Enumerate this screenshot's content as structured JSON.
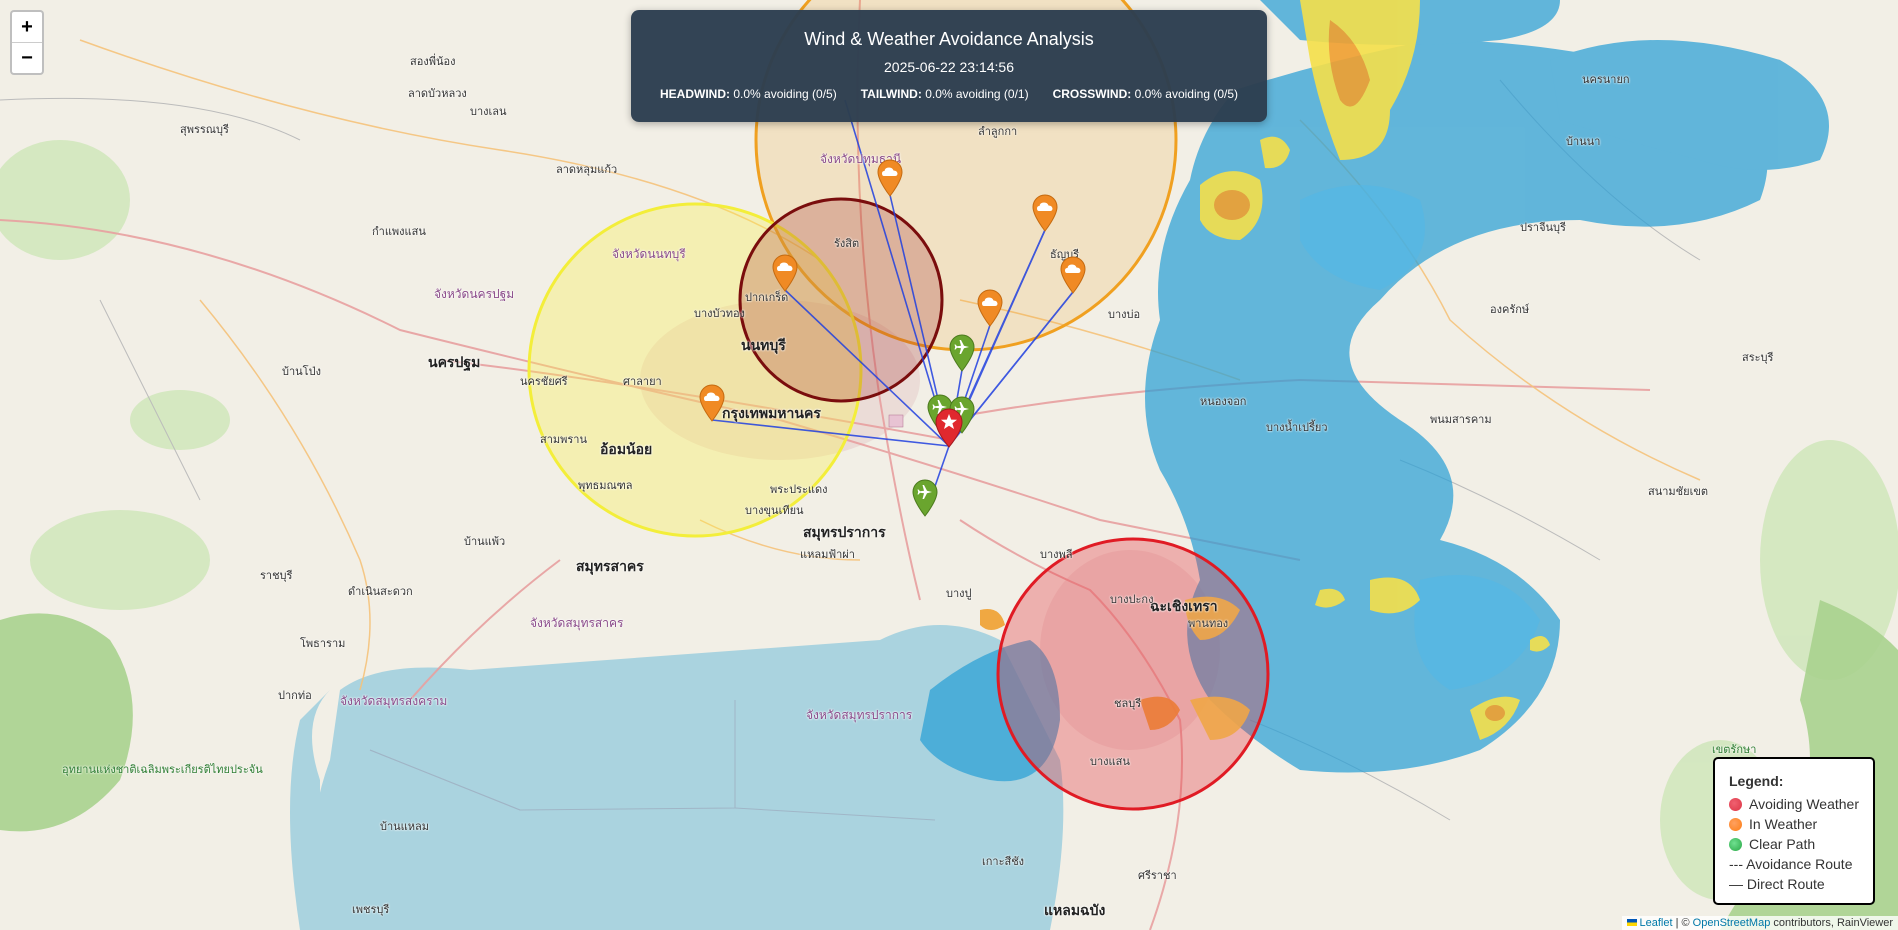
{
  "zoom": {
    "in_label": "+",
    "out_label": "−"
  },
  "panel": {
    "title": "Wind & Weather Avoidance Analysis",
    "timestamp": "2025-06-22 23:14:56",
    "headwind": {
      "label": "HEADWIND:",
      "value": "0.0% avoiding (0/5)"
    },
    "tailwind": {
      "label": "TAILWIND:",
      "value": "0.0% avoiding (0/1)"
    },
    "crosswind": {
      "label": "CROSSWIND:",
      "value": "0.0% avoiding (0/5)"
    }
  },
  "legend": {
    "title": "Legend:",
    "avoiding": "Avoiding Weather",
    "in_weather": "In Weather",
    "clear": "Clear Path",
    "avoid_route": "--- Avoidance Route",
    "direct_route": "— Direct Route",
    "colors": {
      "avoiding": "#dc3545",
      "in_weather": "#fd7e14",
      "clear": "#28a745"
    }
  },
  "attribution": {
    "leaflet": "Leaflet",
    "sep": " | © ",
    "osm": "OpenStreetMap",
    "rest": " contributors, RainViewer"
  },
  "markers": {
    "weather_icon": "cloud-icon",
    "aircraft_icon": "airplane-icon",
    "target_icon": "star-icon"
  },
  "places": [
    {
      "n": "place-1",
      "t": "นครปฐม",
      "k": "city"
    },
    {
      "n": "place-2",
      "t": "นนทบุรี",
      "k": "city"
    },
    {
      "n": "place-3",
      "t": "กรุงเทพมหานคร",
      "k": "city"
    },
    {
      "n": "place-4",
      "t": "สมุทรปราการ",
      "k": "city"
    },
    {
      "n": "place-5",
      "t": "สมุทรสาคร",
      "k": "city"
    },
    {
      "n": "place-6",
      "t": "อ้อมน้อย",
      "k": "city"
    },
    {
      "n": "place-7",
      "t": "จังหวัดนนทบุรี",
      "k": "province"
    },
    {
      "n": "place-8",
      "t": "จังหวัดนครปฐม",
      "k": "province"
    },
    {
      "n": "place-9",
      "t": "จังหวัดปทุมธานี",
      "k": "province"
    },
    {
      "n": "place-10",
      "t": "จังหวัดสมุทรสาคร",
      "k": "province"
    },
    {
      "n": "place-11",
      "t": "จังหวัดสมุทรสงคราม",
      "k": "province"
    },
    {
      "n": "place-12",
      "t": "จังหวัดสมุทรปราการ",
      "k": "province"
    },
    {
      "n": "place-13",
      "t": "แหลมฉบัง",
      "k": "city"
    },
    {
      "n": "place-14",
      "t": "ฉะเชิงเทรา",
      "k": "city"
    },
    {
      "n": "place-15",
      "t": "อุทยานแห่งชาติเฉลิมพระเกียรติไทยประจัน",
      "k": "park"
    },
    {
      "n": "place-16",
      "t": "บางปะกง",
      "k": "normal"
    },
    {
      "n": "place-17",
      "t": "พานทอง",
      "k": "normal"
    },
    {
      "n": "place-18",
      "t": "ชลบุรี",
      "k": "normal"
    },
    {
      "n": "place-19",
      "t": "บางแสน",
      "k": "normal"
    },
    {
      "n": "place-20",
      "t": "เกาะสีชัง",
      "k": "normal"
    },
    {
      "n": "place-21",
      "t": "ศรีราชา",
      "k": "normal"
    },
    {
      "n": "place-22",
      "t": "เพชรบุรี",
      "k": "normal"
    },
    {
      "n": "place-23",
      "t": "บ้านแหลม",
      "k": "normal"
    },
    {
      "n": "place-24",
      "t": "ปากท่อ",
      "k": "normal"
    },
    {
      "n": "place-25",
      "t": "ราชบุรี",
      "k": "normal"
    },
    {
      "n": "place-26",
      "t": "ดำเนินสะดวก",
      "k": "normal"
    },
    {
      "n": "place-27",
      "t": "บ้านแพ้ว",
      "k": "normal"
    },
    {
      "n": "place-28",
      "t": "โพธาราม",
      "k": "normal"
    },
    {
      "n": "place-29",
      "t": "บ้านโป่ง",
      "k": "normal"
    },
    {
      "n": "place-30",
      "t": "กำแพงแสน",
      "k": "normal"
    },
    {
      "n": "place-31",
      "t": "สุพรรณบุรี",
      "k": "normal"
    },
    {
      "n": "place-32",
      "t": "ลาดบัวหลวง",
      "k": "normal"
    },
    {
      "n": "place-33",
      "t": "รังสิต",
      "k": "normal"
    },
    {
      "n": "place-34",
      "t": "ลำลูกกา",
      "k": "normal"
    },
    {
      "n": "place-35",
      "t": "ธัญบุรี",
      "k": "normal"
    },
    {
      "n": "place-36",
      "t": "บางบ่อ",
      "k": "normal"
    },
    {
      "n": "place-37",
      "t": "บางพลี",
      "k": "normal"
    },
    {
      "n": "place-38",
      "t": "บางปู",
      "k": "normal"
    },
    {
      "n": "place-39",
      "t": "สระบุรี",
      "k": "normal"
    },
    {
      "n": "place-40",
      "t": "นครนายก",
      "k": "normal"
    },
    {
      "n": "place-41",
      "t": "ปราจีนบุรี",
      "k": "normal"
    },
    {
      "n": "place-42",
      "t": "องครักษ์",
      "k": "normal"
    },
    {
      "n": "place-43",
      "t": "บ้านนา",
      "k": "normal"
    },
    {
      "n": "place-44",
      "t": "หนองจอก",
      "k": "normal"
    },
    {
      "n": "place-45",
      "t": "บางน้ำเปรี้ยว",
      "k": "normal"
    },
    {
      "n": "place-46",
      "t": "พนมสารคาม",
      "k": "normal"
    },
    {
      "n": "place-47",
      "t": "สนามชัยเขต",
      "k": "normal"
    },
    {
      "n": "place-48",
      "t": "เขตรักษา",
      "k": "park"
    },
    {
      "n": "place-49",
      "t": "ปากเกร็ด",
      "k": "normal"
    },
    {
      "n": "place-50",
      "t": "บางบัวทอง",
      "k": "normal"
    },
    {
      "n": "place-51",
      "t": "สามพราน",
      "k": "normal"
    },
    {
      "n": "place-52",
      "t": "พุทธมณฑล",
      "k": "normal"
    },
    {
      "n": "place-53",
      "t": "พระประแดง",
      "k": "normal"
    },
    {
      "n": "place-54",
      "t": "บางขุนเทียน",
      "k": "normal"
    },
    {
      "n": "place-55",
      "t": "แหลมฟ้าผ่า",
      "k": "normal"
    },
    {
      "n": "place-56",
      "t": "ลาดหลุมแก้ว",
      "k": "normal"
    },
    {
      "n": "place-57",
      "t": "บางเลน",
      "k": "normal"
    },
    {
      "n": "place-58",
      "t": "นครชัยศรี",
      "k": "normal"
    },
    {
      "n": "place-59",
      "t": "ศาลายา",
      "k": "normal"
    },
    {
      "n": "place-60",
      "t": "สองพี่น้อง",
      "k": "normal"
    }
  ]
}
